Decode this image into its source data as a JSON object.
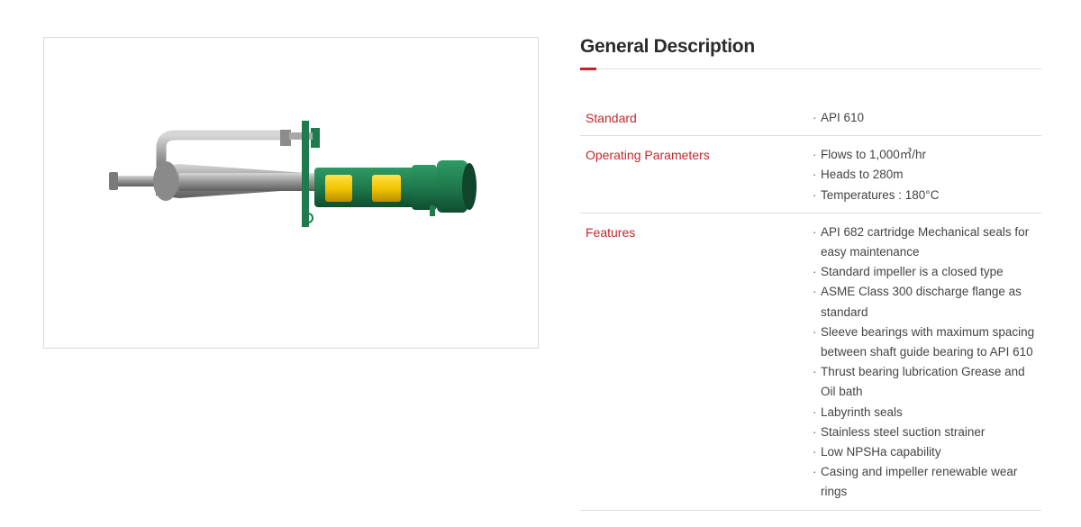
{
  "colors": {
    "accent": "#c8202a",
    "label": "#c0282e",
    "pump_green": "#1f7a4d",
    "pump_yellow": "#f2c500",
    "pipe_steel": "#8e8e8e"
  },
  "product_image": {
    "alt": "Vertical cantilever pump"
  },
  "section": {
    "title": "General Description"
  },
  "specs": [
    {
      "label": "Standard",
      "values": [
        "API 610"
      ]
    },
    {
      "label": "Operating Parameters",
      "values": [
        "Flows to 1,000㎥/hr",
        "Heads to 280m",
        "Temperatures : 180°C"
      ]
    },
    {
      "label": "Features",
      "values": [
        "API 682 cartridge Mechanical seals for easy maintenance",
        "Standard impeller is a closed type",
        "ASME Class 300 discharge flange as standard",
        "Sleeve bearings with maximum spacing between shaft guide bearing to API 610",
        "Thrust bearing lubrication Grease and Oil bath",
        "Labyrinth seals",
        "Stainless steel suction strainer",
        "Low NPSHa capability",
        "Casing and impeller renewable wear rings"
      ]
    }
  ],
  "bullet_glyph": "·"
}
